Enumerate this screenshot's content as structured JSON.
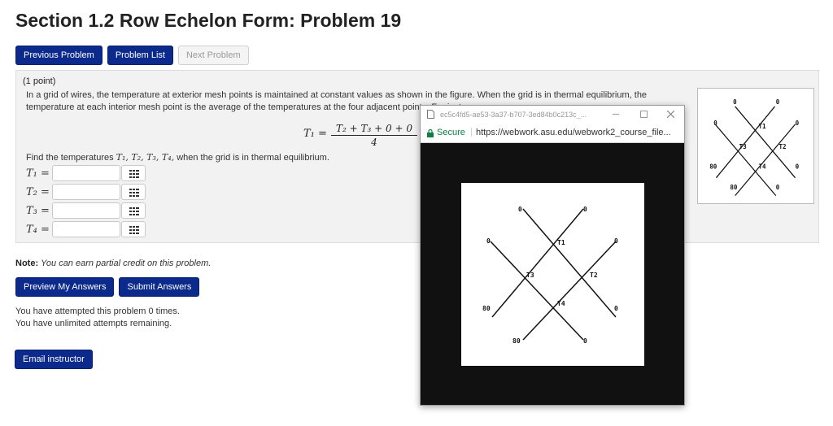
{
  "page": {
    "title": "Section 1.2 Row Echelon Form: Problem 19"
  },
  "nav": {
    "previous": "Previous Problem",
    "list": "Problem List",
    "next": "Next Problem"
  },
  "problem": {
    "points": "(1 point)",
    "text": "In a grid of wires, the temperature at exterior mesh points is maintained at constant values as shown in the figure. When the grid is in thermal equilibrium, the temperature at each interior mesh point is the average of the temperatures at the four adjacent points. For instance,",
    "formula_lhs": "T₁ =",
    "formula_numerator": "T₂ + T₃ + 0 + 0",
    "formula_denominator": "4",
    "formula_period": ".",
    "find_prefix": "Find the temperatures ",
    "find_vars": "T₁, T₂, T₃, T₄,",
    "find_suffix": " when the grid is in thermal equilibrium.",
    "answers": [
      {
        "label": "T₁ =",
        "value": ""
      },
      {
        "label": "T₂ =",
        "value": ""
      },
      {
        "label": "T₃ =",
        "value": ""
      },
      {
        "label": "T₄ =",
        "value": ""
      }
    ]
  },
  "popup": {
    "tab_title": "ec5c4fd5-ae53-3a37-b707-3ed84b0c213c_...",
    "secure_label": "Secure",
    "url": "https://webwork.asu.edu/webwork2_course_file...",
    "figure": {
      "labels": [
        "0",
        "0",
        "0",
        "0",
        "80",
        "80",
        "0",
        "0"
      ],
      "nodes": [
        "T1",
        "T2",
        "T3",
        "T4"
      ]
    }
  },
  "note": {
    "label": "Note:",
    "text": "You can earn partial credit on this problem."
  },
  "actions": {
    "preview": "Preview My Answers",
    "submit": "Submit Answers"
  },
  "attempts": {
    "line1": "You have attempted this problem 0 times.",
    "line2": "You have unlimited attempts remaining."
  },
  "email": {
    "label": "Email instructor"
  },
  "colors": {
    "primary_button": "#0b2a8c",
    "panel": "#f2f2f2",
    "secure_green": "#0b8043"
  }
}
